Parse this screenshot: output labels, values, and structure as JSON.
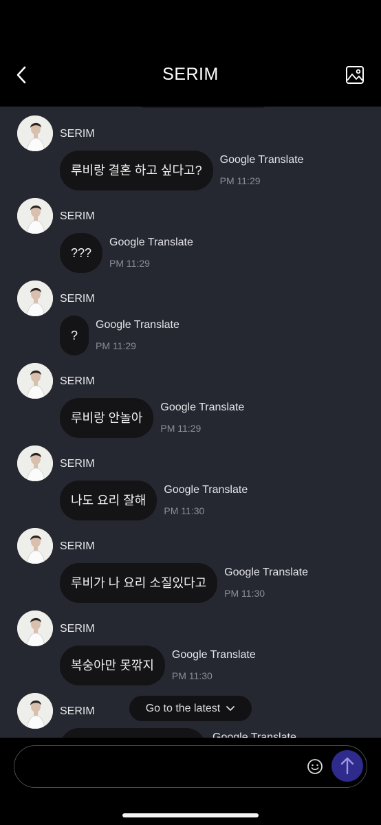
{
  "header": {
    "title": "SERIM",
    "back_icon": "chevron-left-icon",
    "gallery_icon": "image-icon"
  },
  "messages": [
    {
      "sender": "SERIM",
      "text": "루비랑 결혼 하고 싶다고?",
      "translate": "Google Translate",
      "time": "PM 11:29"
    },
    {
      "sender": "SERIM",
      "text": "???",
      "translate": "Google Translate",
      "time": "PM 11:29"
    },
    {
      "sender": "SERIM",
      "text": "?",
      "translate": "Google Translate",
      "time": "PM 11:29"
    },
    {
      "sender": "SERIM",
      "text": "루비랑 안놀아",
      "translate": "Google Translate",
      "time": "PM 11:29"
    },
    {
      "sender": "SERIM",
      "text": "나도 요리 잘해",
      "translate": "Google Translate",
      "time": "PM 11:30"
    },
    {
      "sender": "SERIM",
      "text": "루비가 나 요리 소질있다고",
      "translate": "Google Translate",
      "time": "PM 11:30"
    },
    {
      "sender": "SERIM",
      "text": "복숭아만 못깎지",
      "translate": "Google Translate",
      "time": "PM 11:30"
    },
    {
      "sender": "SERIM",
      "text": "",
      "translate": "Google Translate",
      "time": ""
    }
  ],
  "jump_button": {
    "label": "Go to the latest",
    "icon": "chevron-down-icon"
  },
  "composer": {
    "value": "",
    "placeholder": "",
    "emoji_icon": "smiley-icon",
    "send_icon": "arrow-up-icon"
  },
  "colors": {
    "background": "#262831",
    "bubble": "#141416",
    "send_button": "#2f2b8c",
    "header": "#000000"
  }
}
